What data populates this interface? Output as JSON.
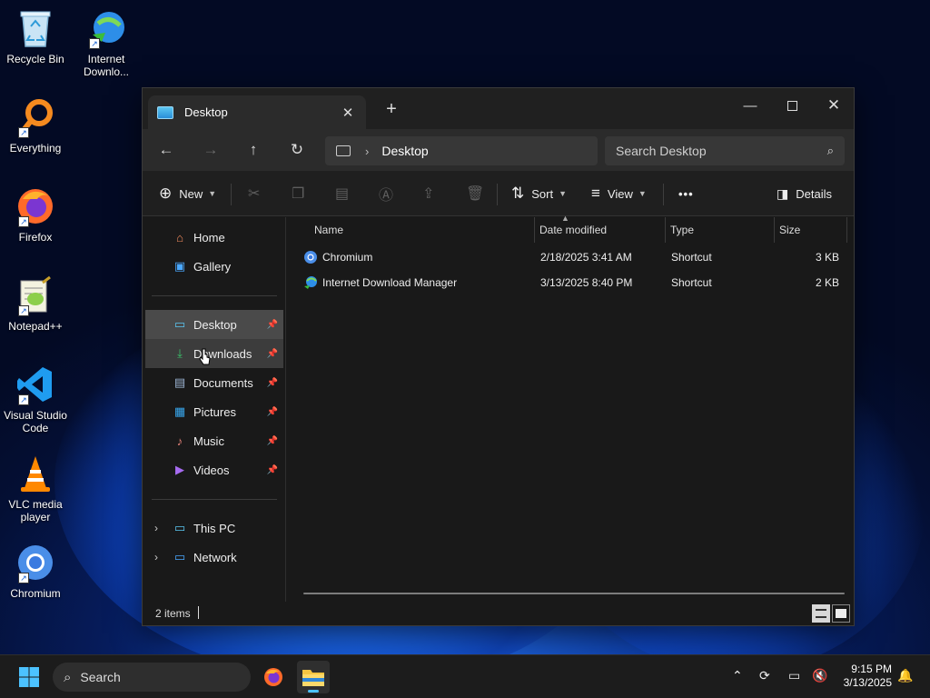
{
  "desktop": {
    "icons": [
      {
        "label": "Recycle Bin"
      },
      {
        "label": "Internet Downlo..."
      },
      {
        "label": "Everything"
      },
      {
        "label": "Firefox"
      },
      {
        "label": "Notepad++"
      },
      {
        "label": "Visual Studio Code"
      },
      {
        "label": "VLC media player"
      },
      {
        "label": "Chromium"
      }
    ]
  },
  "window": {
    "tab_title": "Desktop",
    "address": {
      "crumb": "Desktop"
    },
    "search": {
      "placeholder": "Search Desktop"
    },
    "commands": {
      "new_label": "New",
      "sort_label": "Sort",
      "view_label": "View",
      "more_label": "•••",
      "details_label": "Details"
    },
    "sidebar": {
      "top": [
        {
          "label": "Home"
        },
        {
          "label": "Gallery"
        }
      ],
      "quick_access": [
        {
          "label": "Desktop",
          "selected": true
        },
        {
          "label": "Downloads"
        },
        {
          "label": "Documents"
        },
        {
          "label": "Pictures"
        },
        {
          "label": "Music"
        },
        {
          "label": "Videos"
        }
      ],
      "tree": [
        {
          "label": "This PC"
        },
        {
          "label": "Network"
        }
      ]
    },
    "columns": {
      "name": "Name",
      "date": "Date modified",
      "type": "Type",
      "size": "Size"
    },
    "files": [
      {
        "name": "Chromium",
        "date": "2/18/2025 3:41 AM",
        "type": "Shortcut",
        "size": "3 KB"
      },
      {
        "name": "Internet Download Manager",
        "date": "3/13/2025 8:40 PM",
        "type": "Shortcut",
        "size": "2 KB"
      }
    ],
    "status": {
      "item_count": "2 items"
    }
  },
  "taskbar": {
    "search_label": "Search",
    "time": "9:15 PM",
    "date": "3/13/2025"
  },
  "colors": {
    "accent": "#4cc2ff",
    "window_bg": "#191919",
    "selected_bg": "#4a4a4a"
  }
}
